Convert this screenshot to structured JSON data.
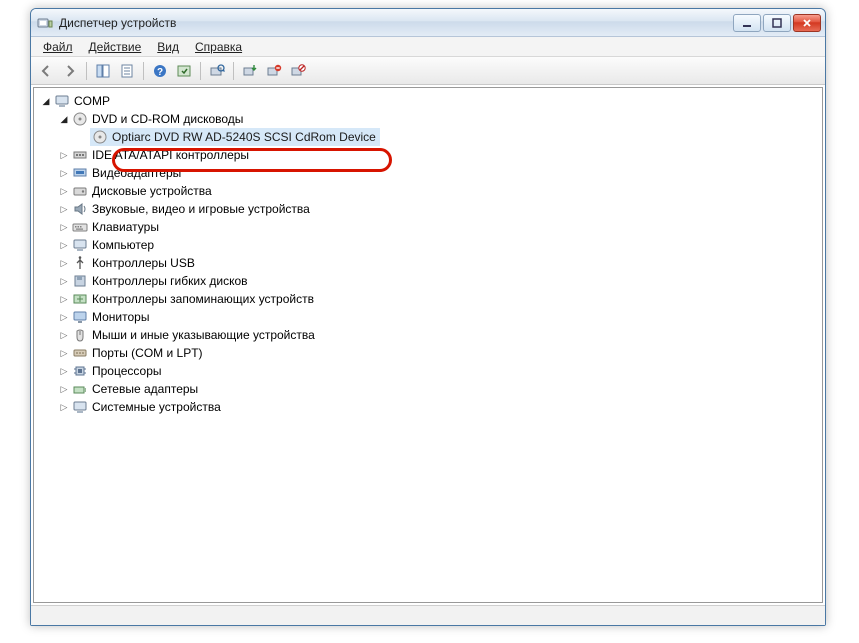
{
  "window": {
    "title": "Диспетчер устройств"
  },
  "menu": {
    "file": "Файл",
    "action": "Действие",
    "view": "Вид",
    "help": "Справка"
  },
  "tree": {
    "root": "COMP",
    "dvd_category": "DVD и CD-ROM дисководы",
    "dvd_device": "Optiarc DVD RW AD-5240S SCSI CdRom Device",
    "categories": [
      "IDE ATA/ATAPI контроллеры",
      "Видеоадаптеры",
      "Дисковые устройства",
      "Звуковые, видео и игровые устройства",
      "Клавиатуры",
      "Компьютер",
      "Контроллеры USB",
      "Контроллеры гибких дисков",
      "Контроллеры запоминающих устройств",
      "Мониторы",
      "Мыши и иные указывающие устройства",
      "Порты (COM и LPT)",
      "Процессоры",
      "Сетевые адаптеры",
      "Системные устройства"
    ]
  }
}
